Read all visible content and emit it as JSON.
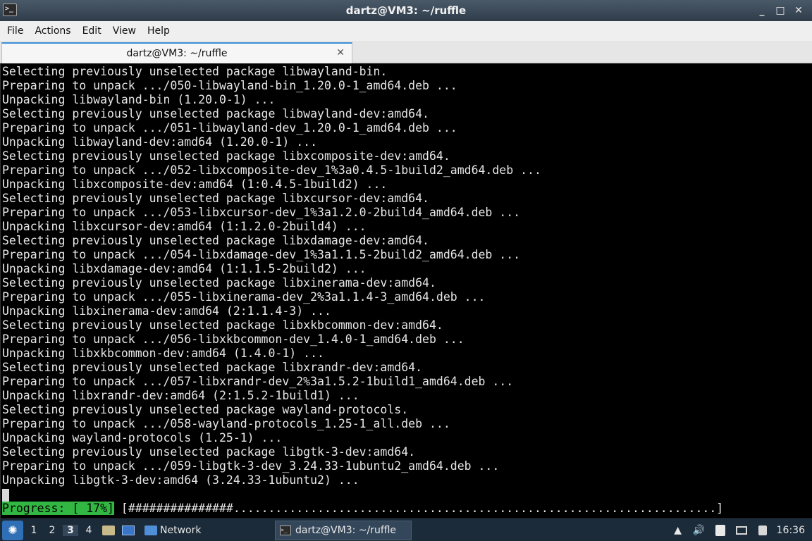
{
  "window": {
    "title": "dartz@VM3: ~/ruffle",
    "app_icon_glyph": ">_",
    "controls": [
      "_",
      "□",
      "✕"
    ]
  },
  "menu": {
    "items": [
      "File",
      "Actions",
      "Edit",
      "View",
      "Help"
    ]
  },
  "tab": {
    "label": "dartz@VM3: ~/ruffle",
    "close_glyph": "✕"
  },
  "terminal": {
    "lines": [
      "Selecting previously unselected package libwayland-bin.",
      "Preparing to unpack .../050-libwayland-bin_1.20.0-1_amd64.deb ...",
      "Unpacking libwayland-bin (1.20.0-1) ...",
      "Selecting previously unselected package libwayland-dev:amd64.",
      "Preparing to unpack .../051-libwayland-dev_1.20.0-1_amd64.deb ...",
      "Unpacking libwayland-dev:amd64 (1.20.0-1) ...",
      "Selecting previously unselected package libxcomposite-dev:amd64.",
      "Preparing to unpack .../052-libxcomposite-dev_1%3a0.4.5-1build2_amd64.deb ...",
      "Unpacking libxcomposite-dev:amd64 (1:0.4.5-1build2) ...",
      "Selecting previously unselected package libxcursor-dev:amd64.",
      "Preparing to unpack .../053-libxcursor-dev_1%3a1.2.0-2build4_amd64.deb ...",
      "Unpacking libxcursor-dev:amd64 (1:1.2.0-2build4) ...",
      "Selecting previously unselected package libxdamage-dev:amd64.",
      "Preparing to unpack .../054-libxdamage-dev_1%3a1.1.5-2build2_amd64.deb ...",
      "Unpacking libxdamage-dev:amd64 (1:1.1.5-2build2) ...",
      "Selecting previously unselected package libxinerama-dev:amd64.",
      "Preparing to unpack .../055-libxinerama-dev_2%3a1.1.4-3_amd64.deb ...",
      "Unpacking libxinerama-dev:amd64 (2:1.1.4-3) ...",
      "Selecting previously unselected package libxkbcommon-dev:amd64.",
      "Preparing to unpack .../056-libxkbcommon-dev_1.4.0-1_amd64.deb ...",
      "Unpacking libxkbcommon-dev:amd64 (1.4.0-1) ...",
      "Selecting previously unselected package libxrandr-dev:amd64.",
      "Preparing to unpack .../057-libxrandr-dev_2%3a1.5.2-1build1_amd64.deb ...",
      "Unpacking libxrandr-dev:amd64 (2:1.5.2-1build1) ...",
      "Selecting previously unselected package wayland-protocols.",
      "Preparing to unpack .../058-wayland-protocols_1.25-1_all.deb ...",
      "Unpacking wayland-protocols (1.25-1) ...",
      "Selecting previously unselected package libgtk-3-dev:amd64.",
      "Preparing to unpack .../059-libgtk-3-dev_3.24.33-1ubuntu2_amd64.deb ...",
      "Unpacking libgtk-3-dev:amd64 (3.24.33-1ubuntu2) ..."
    ],
    "progress_label": "Progress: [ 17%]",
    "progress_bar": " [###############.....................................................................]",
    "progress_percent": 17,
    "progress_color": "#32b842"
  },
  "taskbar": {
    "start_glyph": "✺",
    "workspaces": [
      "1",
      "2",
      "3",
      "4"
    ],
    "active_workspace": "3",
    "network_label": "Network",
    "terminal_task_label": "dartz@VM3: ~/ruffle",
    "tray": {
      "up_glyph": "▲",
      "volume_glyph": "🔊",
      "clock": "16:36"
    }
  }
}
